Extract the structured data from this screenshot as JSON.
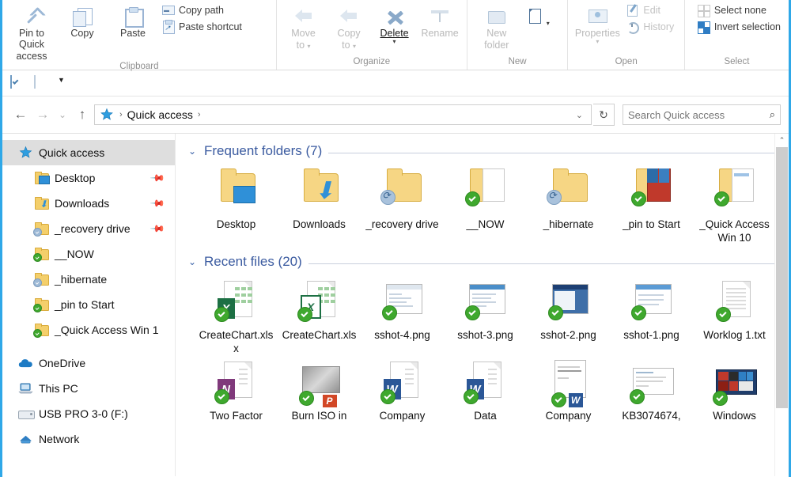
{
  "ribbon": {
    "groups": [
      {
        "label": "Clipboard",
        "big": [
          {
            "name": "pin-to-quick-access",
            "line1": "Pin to Quick",
            "line2": "access"
          },
          {
            "name": "copy",
            "line1": "Copy",
            "line2": ""
          },
          {
            "name": "paste",
            "line1": "Paste",
            "line2": ""
          }
        ],
        "small": [
          {
            "name": "copy-path",
            "label": "Copy path"
          },
          {
            "name": "paste-shortcut",
            "label": "Paste shortcut"
          }
        ]
      },
      {
        "label": "Organize",
        "big": [
          {
            "name": "move-to",
            "line1": "Move",
            "line2": "to"
          },
          {
            "name": "copy-to",
            "line1": "Copy",
            "line2": "to"
          },
          {
            "name": "delete",
            "line1": "Delete",
            "line2": ""
          },
          {
            "name": "rename",
            "line1": "Rename",
            "line2": ""
          }
        ],
        "small": []
      },
      {
        "label": "New",
        "big": [
          {
            "name": "new-folder",
            "line1": "New",
            "line2": "folder"
          },
          {
            "name": "new-item",
            "line1": "",
            "line2": ""
          }
        ],
        "small": []
      },
      {
        "label": "Open",
        "big": [
          {
            "name": "properties",
            "line1": "Properties",
            "line2": ""
          }
        ],
        "small": [
          {
            "name": "edit",
            "label": "Edit"
          },
          {
            "name": "history",
            "label": "History"
          }
        ]
      },
      {
        "label": "Select",
        "big": [],
        "small": [
          {
            "name": "select-none",
            "label": "Select none"
          },
          {
            "name": "invert-selection",
            "label": "Invert selection"
          }
        ]
      }
    ]
  },
  "addressbar": {
    "back": "←",
    "forward": "→",
    "recent": "⌄",
    "up": "↑",
    "crumb": "Quick access",
    "sep": "›",
    "dropdown": "⌄",
    "refresh": "↻"
  },
  "search": {
    "placeholder": "Search Quick access",
    "icon": "search-icon"
  },
  "sidebar": {
    "items": [
      {
        "label": "Quick access",
        "icon": "star-icon",
        "selected": true,
        "indent": false,
        "pin": false,
        "badge": "none"
      },
      {
        "label": "Desktop",
        "icon": "folder-desktop",
        "selected": false,
        "indent": true,
        "pin": true,
        "badge": "none"
      },
      {
        "label": "Downloads",
        "icon": "folder-downloads",
        "selected": false,
        "indent": true,
        "pin": true,
        "badge": "none"
      },
      {
        "label": "_recovery drive",
        "icon": "folder",
        "selected": false,
        "indent": true,
        "pin": true,
        "badge": "sync"
      },
      {
        "label": "__NOW",
        "icon": "folder",
        "selected": false,
        "indent": true,
        "pin": false,
        "badge": "ok"
      },
      {
        "label": "_hibernate",
        "icon": "folder",
        "selected": false,
        "indent": true,
        "pin": false,
        "badge": "sync"
      },
      {
        "label": "_pin to Start",
        "icon": "folder",
        "selected": false,
        "indent": true,
        "pin": false,
        "badge": "ok"
      },
      {
        "label": "_Quick Access Win 1",
        "icon": "folder",
        "selected": false,
        "indent": true,
        "pin": false,
        "badge": "ok"
      },
      {
        "label": "OneDrive",
        "icon": "cloud-icon",
        "selected": false,
        "indent": false,
        "pin": false,
        "badge": "none"
      },
      {
        "label": "This PC",
        "icon": "pc-icon",
        "selected": false,
        "indent": false,
        "pin": false,
        "badge": "none"
      },
      {
        "label": "USB PRO 3-0 (F:)",
        "icon": "usb-icon",
        "selected": false,
        "indent": false,
        "pin": false,
        "badge": "none"
      },
      {
        "label": "Network",
        "icon": "network-icon",
        "selected": false,
        "indent": false,
        "pin": false,
        "badge": "none"
      }
    ]
  },
  "main": {
    "sections": [
      {
        "title": "Frequent folders (7)",
        "chevron": "⌄",
        "items": [
          {
            "name": "Desktop",
            "kind": "folder",
            "overlay": "monitor",
            "badge": "none"
          },
          {
            "name": "Downloads",
            "kind": "folder",
            "overlay": "arrow",
            "badge": "none"
          },
          {
            "name": "_recovery drive",
            "kind": "folder",
            "overlay": "none",
            "badge": "sync"
          },
          {
            "name": "__NOW",
            "kind": "folder",
            "overlay": "docs",
            "badge": "ok"
          },
          {
            "name": "_hibernate",
            "kind": "folder",
            "overlay": "none",
            "badge": "sync"
          },
          {
            "name": "_pin to Start",
            "kind": "folder",
            "overlay": "tiles",
            "badge": "ok"
          },
          {
            "name": "_Quick Access Win 10",
            "kind": "folder",
            "overlay": "docs",
            "badge": "ok"
          }
        ]
      },
      {
        "title": "Recent files (20)",
        "chevron": "⌄",
        "items": [
          {
            "name": "CreateChart.xlsx",
            "kind": "excel",
            "letter": "X",
            "badge": "ok"
          },
          {
            "name": "CreateChart.xls",
            "kind": "excel-old",
            "letter": "X",
            "badge": "ok"
          },
          {
            "name": "sshot-4.png",
            "kind": "image",
            "badge": "ok"
          },
          {
            "name": "sshot-3.png",
            "kind": "image",
            "badge": "ok"
          },
          {
            "name": "sshot-2.png",
            "kind": "image-dark",
            "badge": "ok"
          },
          {
            "name": "sshot-1.png",
            "kind": "image",
            "badge": "ok"
          },
          {
            "name": "Worklog 1.txt",
            "kind": "text",
            "badge": "ok"
          },
          {
            "name": "Two Factor",
            "kind": "onenote",
            "letter": "N",
            "badge": "ok"
          },
          {
            "name": "Burn ISO in",
            "kind": "powerpoint",
            "letter": "P",
            "badge": "ok"
          },
          {
            "name": "Company",
            "kind": "word",
            "letter": "W",
            "badge": "ok"
          },
          {
            "name": "Data",
            "kind": "word",
            "letter": "W",
            "badge": "ok"
          },
          {
            "name": "Company",
            "kind": "word-doc",
            "letter": "W",
            "badge": "ok"
          },
          {
            "name": "KB3074674,",
            "kind": "document",
            "badge": "ok"
          },
          {
            "name": "Windows",
            "kind": "tiles",
            "badge": "ok"
          }
        ]
      }
    ]
  },
  "scrollbar": {
    "up": "⌃",
    "down": "⌄"
  },
  "colors": {
    "accent": "#2fa8e8",
    "section": "#3b5ba0",
    "folder": "#f6d684",
    "ok": "#3fa82e"
  }
}
